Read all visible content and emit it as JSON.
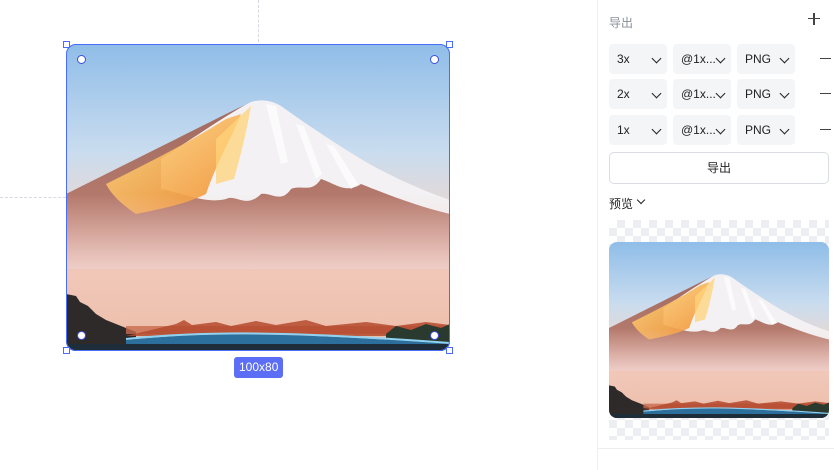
{
  "canvas": {
    "size_label": "100x80"
  },
  "panel": {
    "title": "导出",
    "rows": [
      {
        "scale": "3x",
        "suffix": "@1x...",
        "format": "PNG"
      },
      {
        "scale": "2x",
        "suffix": "@1x...",
        "format": "PNG"
      },
      {
        "scale": "1x",
        "suffix": "@1x...",
        "format": "PNG"
      }
    ],
    "export_button": "导出",
    "preview_label": "预览"
  },
  "colors": {
    "selection": "#4a6cf7",
    "badge": "#5b6ef5"
  },
  "icons": [
    "plus-icon",
    "minus-icon",
    "chevron-down-icon"
  ]
}
